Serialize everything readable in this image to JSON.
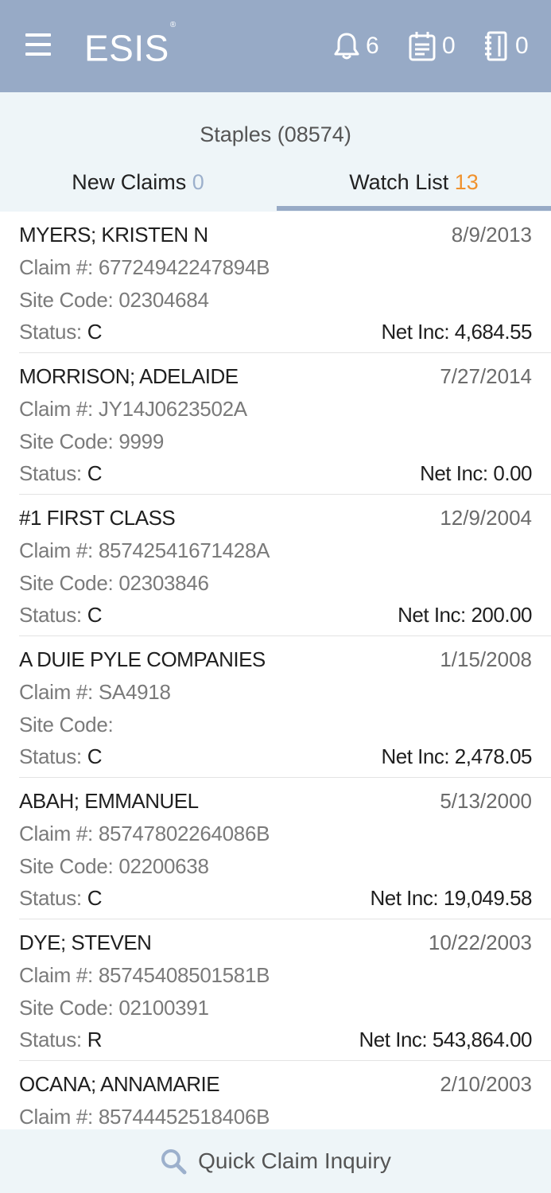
{
  "header": {
    "logo": "ESIS",
    "logo_mark": "®",
    "notifications_count": "6",
    "calendar_count": "0",
    "documents_count": "0"
  },
  "client": "Staples (08574)",
  "tabs": {
    "new_claims": {
      "label": "New Claims",
      "count": "0"
    },
    "watch_list": {
      "label": "Watch List",
      "count": "13"
    }
  },
  "labels": {
    "claim": "Claim #: ",
    "site": "Site Code: ",
    "status": "Status: ",
    "netinc": "Net Inc: "
  },
  "claims": [
    {
      "name": "MYERS; KRISTEN N",
      "date": "8/9/2013",
      "claim_no": "67724942247894B",
      "site_code": "02304684",
      "status": "C",
      "net_inc": "4,684.55"
    },
    {
      "name": "MORRISON; ADELAIDE",
      "date": "7/27/2014",
      "claim_no": "JY14J0623502A",
      "site_code": "9999",
      "status": "C",
      "net_inc": "0.00"
    },
    {
      "name": "#1 FIRST CLASS",
      "date": "12/9/2004",
      "claim_no": "85742541671428A",
      "site_code": "02303846",
      "status": "C",
      "net_inc": "200.00"
    },
    {
      "name": "A DUIE PYLE COMPANIES",
      "date": "1/15/2008",
      "claim_no": "SA4918",
      "site_code": "",
      "status": "C",
      "net_inc": "2,478.05"
    },
    {
      "name": "ABAH; EMMANUEL",
      "date": "5/13/2000",
      "claim_no": "85747802264086B",
      "site_code": "02200638",
      "status": "C",
      "net_inc": "19,049.58"
    },
    {
      "name": "DYE; STEVEN",
      "date": "10/22/2003",
      "claim_no": "85745408501581B",
      "site_code": "02100391",
      "status": "R",
      "net_inc": "543,864.00"
    },
    {
      "name": "OCANA; ANNAMARIE",
      "date": "2/10/2003",
      "claim_no": "85744452518406B",
      "site_code": "",
      "status": "",
      "net_inc": ""
    }
  ],
  "bottom": {
    "label": "Quick Claim Inquiry"
  },
  "colors": {
    "header_bg": "#97aac6",
    "subheader_bg": "#eef5f8",
    "count_blue": "#9cb0cc",
    "count_orange": "#f0922e"
  }
}
